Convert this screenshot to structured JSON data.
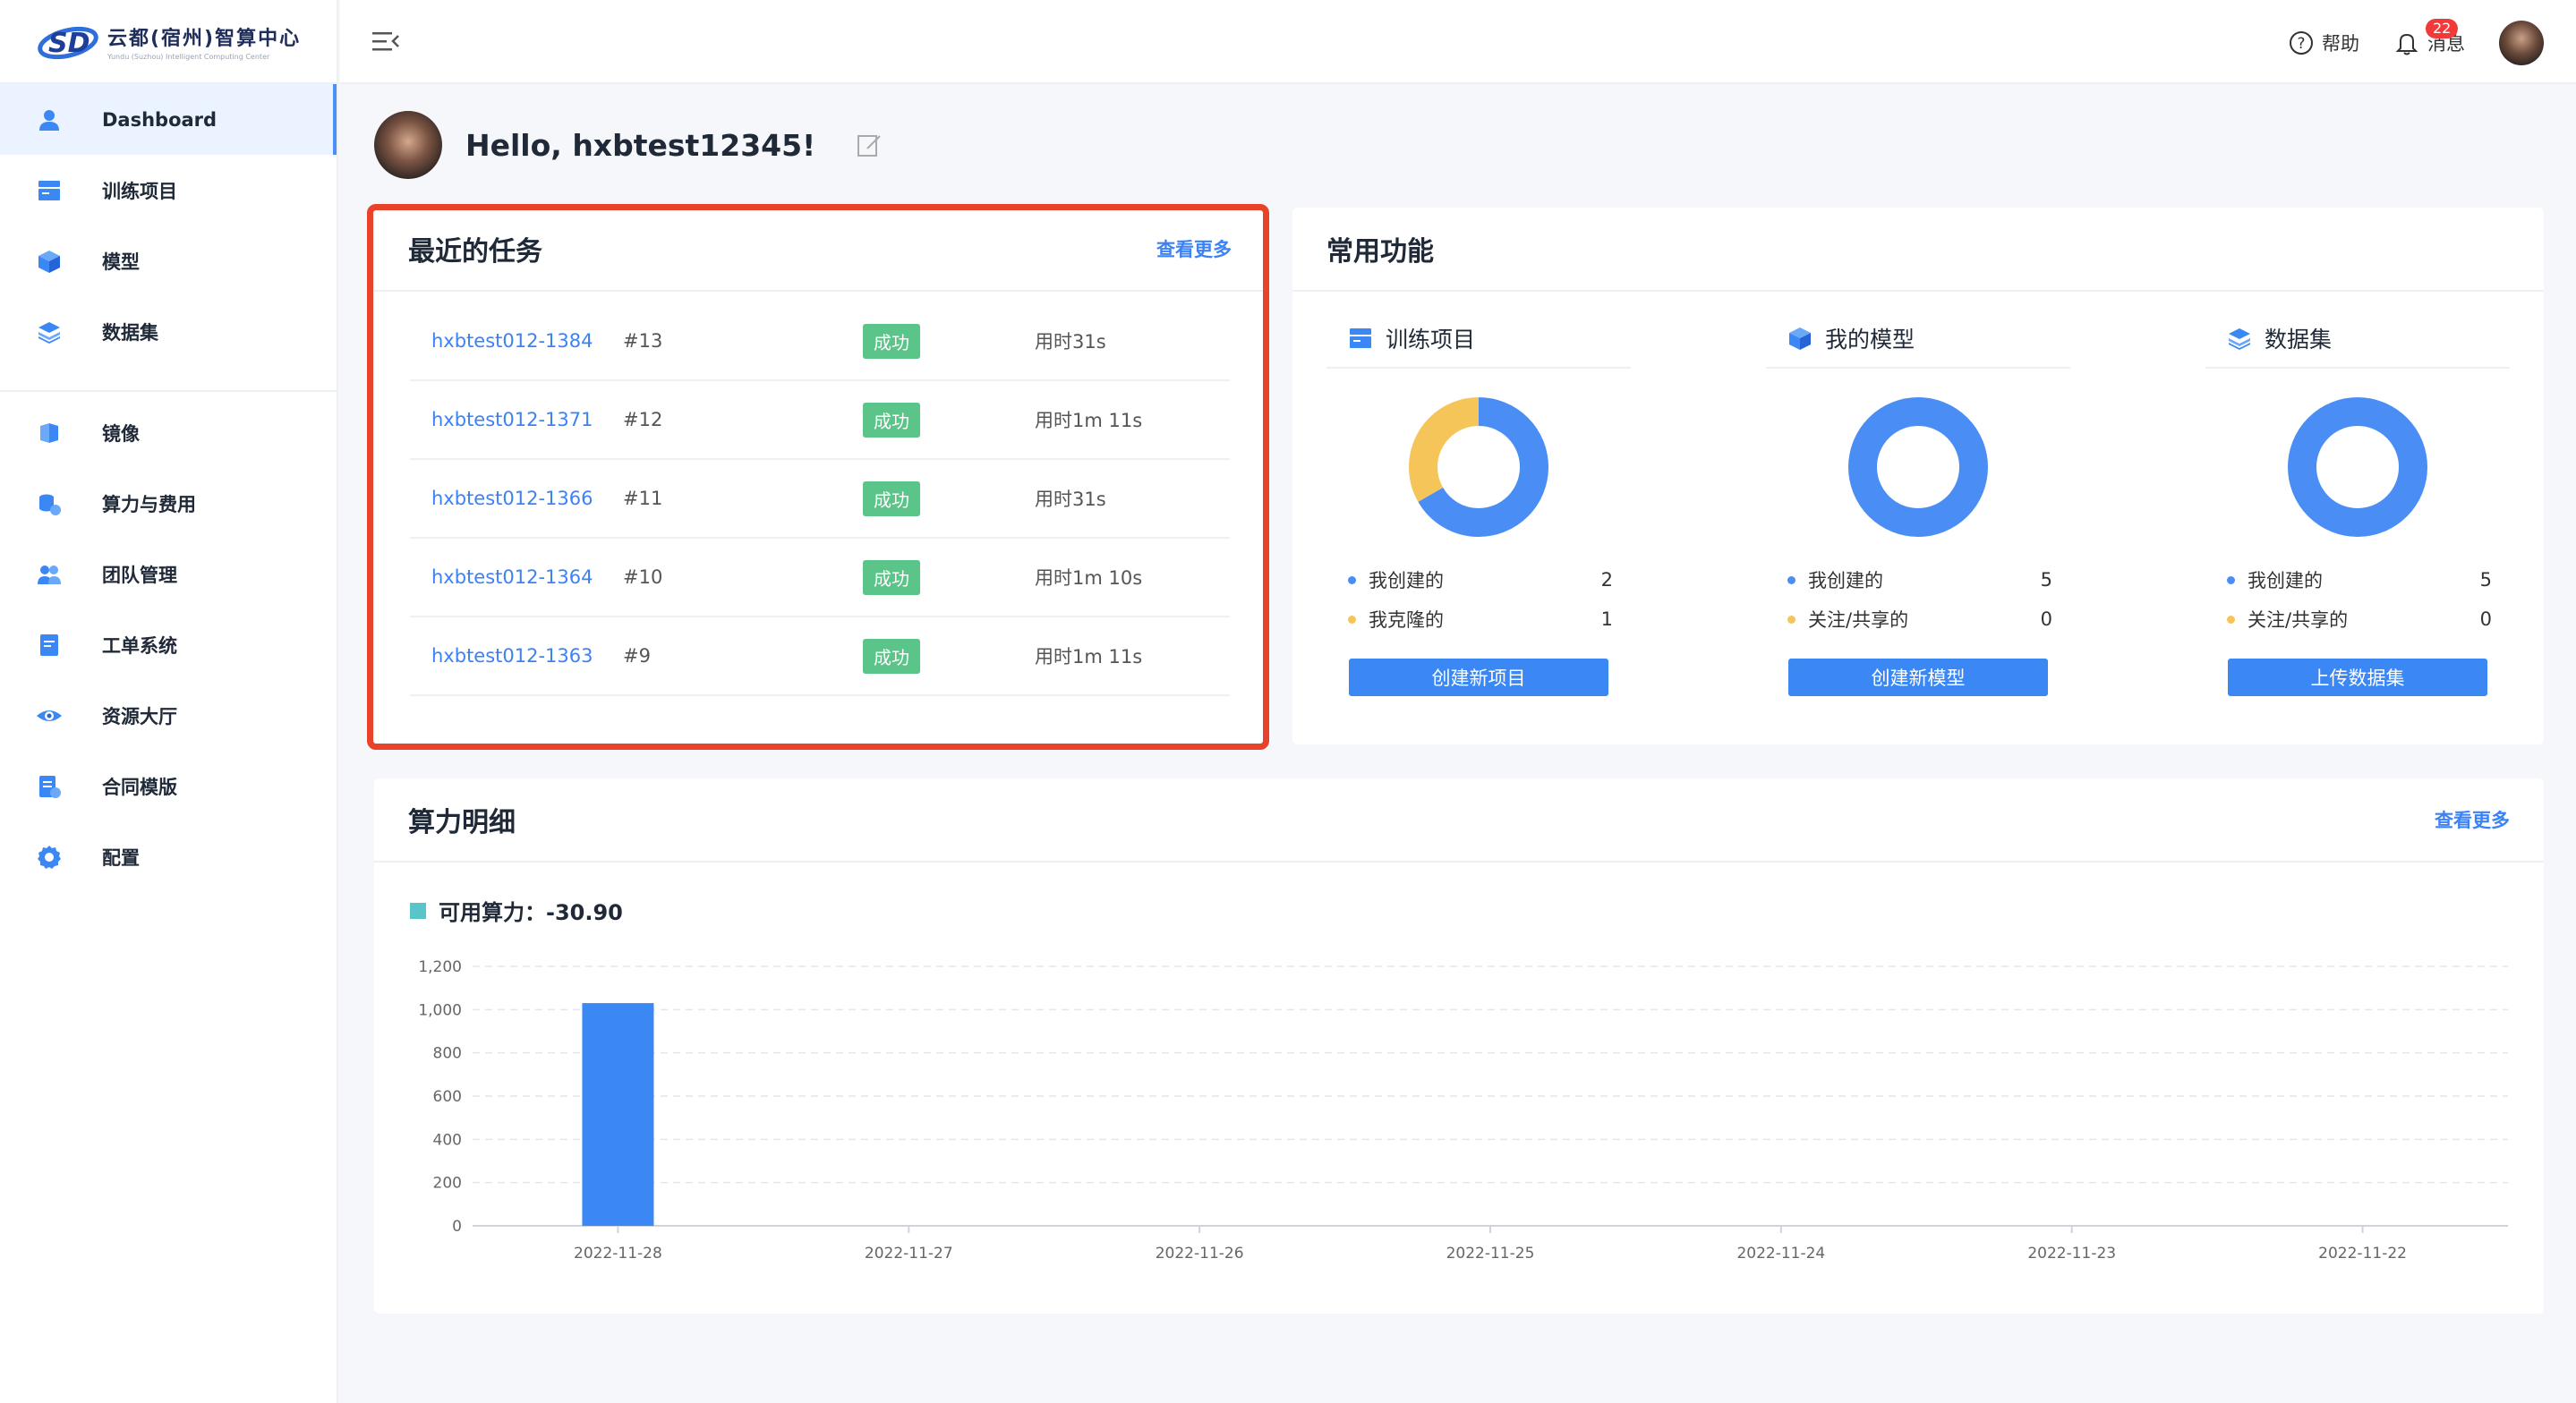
{
  "app": {
    "logo_title": "云都(宿州)智算中心",
    "logo_subtitle": "Yundu (Suzhou) Intelligent Computing Center"
  },
  "sidebar": {
    "items": [
      {
        "label": "Dashboard",
        "icon": "user-icon",
        "active": true
      },
      {
        "label": "训练项目",
        "icon": "project-icon"
      },
      {
        "label": "模型",
        "icon": "cube-icon"
      },
      {
        "label": "数据集",
        "icon": "layers-icon"
      },
      {
        "label": "镜像",
        "icon": "mirror-icon"
      },
      {
        "label": "算力与费用",
        "icon": "billing-icon"
      },
      {
        "label": "团队管理",
        "icon": "team-icon"
      },
      {
        "label": "工单系统",
        "icon": "ticket-icon"
      },
      {
        "label": "资源大厅",
        "icon": "eye-icon"
      },
      {
        "label": "合同模版",
        "icon": "contract-icon"
      },
      {
        "label": "配置",
        "icon": "gear-icon"
      }
    ]
  },
  "topbar": {
    "help_label": "帮助",
    "messages_label": "消息",
    "messages_count": "22"
  },
  "greeting": "Hello, hxbtest12345!",
  "recent_tasks": {
    "title": "最近的任务",
    "more_label": "查看更多",
    "rows": [
      {
        "name": "hxbtest012-1384",
        "num": "#13",
        "status": "成功",
        "time": "用时31s"
      },
      {
        "name": "hxbtest012-1371",
        "num": "#12",
        "status": "成功",
        "time": "用时1m 11s"
      },
      {
        "name": "hxbtest012-1366",
        "num": "#11",
        "status": "成功",
        "time": "用时31s"
      },
      {
        "name": "hxbtest012-1364",
        "num": "#10",
        "status": "成功",
        "time": "用时1m 10s"
      },
      {
        "name": "hxbtest012-1363",
        "num": "#9",
        "status": "成功",
        "time": "用时1m 11s"
      }
    ]
  },
  "common_functions": {
    "title": "常用功能",
    "cards": [
      {
        "title": "训练项目",
        "icon": "project-icon",
        "legend": [
          {
            "label": "我创建的",
            "value": "2",
            "color": "#4a8ef5"
          },
          {
            "label": "我克隆的",
            "value": "1",
            "color": "#f5c55a"
          }
        ],
        "button": "创建新项目"
      },
      {
        "title": "我的模型",
        "icon": "cube-icon",
        "legend": [
          {
            "label": "我创建的",
            "value": "5",
            "color": "#4a8ef5"
          },
          {
            "label": "关注/共享的",
            "value": "0",
            "color": "#f5c55a"
          }
        ],
        "button": "创建新模型"
      },
      {
        "title": "数据集",
        "icon": "layers-icon",
        "legend": [
          {
            "label": "我创建的",
            "value": "5",
            "color": "#4a8ef5"
          },
          {
            "label": "关注/共享的",
            "value": "0",
            "color": "#f5c55a"
          }
        ],
        "button": "上传数据集"
      }
    ]
  },
  "compute_detail": {
    "title": "算力明细",
    "more_label": "查看更多",
    "available_label": "可用算力：",
    "available_value": "-30.90"
  },
  "chart_data": {
    "type": "bar",
    "categories": [
      "2022-11-28",
      "2022-11-27",
      "2022-11-26",
      "2022-11-25",
      "2022-11-24",
      "2022-11-23",
      "2022-11-22"
    ],
    "values": [
      1030,
      0,
      0,
      0,
      0,
      0,
      0
    ],
    "yticks": [
      "0",
      "200",
      "400",
      "600",
      "800",
      "1,000",
      "1,200"
    ],
    "ylim": [
      0,
      1200
    ],
    "bar_color": "#3b88f5",
    "grid": true
  }
}
